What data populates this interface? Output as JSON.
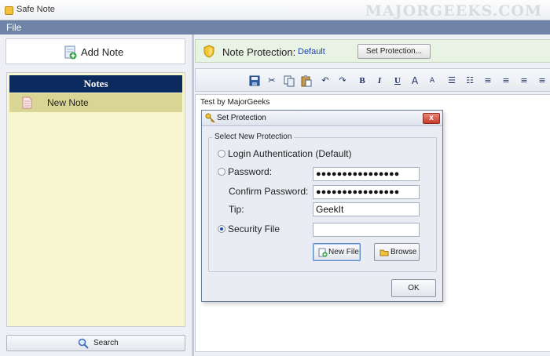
{
  "window": {
    "title": "Safe Note",
    "watermark": "MAJORGEEKS.COM"
  },
  "menu": {
    "file": "File"
  },
  "sidebar": {
    "add_note_label": "Add Note",
    "notes_header": "Notes",
    "notes": [
      {
        "label": "New Note"
      }
    ],
    "search_label": "Search"
  },
  "protection": {
    "label": "Note Protection:",
    "value": "Default",
    "set_button": "Set Protection..."
  },
  "toolbar": {
    "bold": "B",
    "italic": "I",
    "underline": "U",
    "grow_font": "A",
    "shrink_font": "A"
  },
  "editor": {
    "content": "Test by MajorGeeks"
  },
  "dialog": {
    "title": "Set Protection",
    "close": "x",
    "group_label": "Select New Protection",
    "option_login": "Login Authentication (Default)",
    "option_password": "Password:",
    "password_value": "●●●●●●●●●●●●●●●●",
    "confirm_label": "Confirm Password:",
    "confirm_value": "●●●●●●●●●●●●●●●●",
    "tip_label": "Tip:",
    "tip_value": "GeekIt",
    "option_security_file": "Security File",
    "security_file_value": "",
    "new_file_button": "New File",
    "browse_button": "Browse",
    "ok_button": "OK"
  },
  "colors": {
    "menubar": "#6e83a5",
    "notes_header": "#0b2a5e",
    "notes_panel": "#f8f6cf",
    "selected_note": "#d9d595",
    "protection_value": "#1d3fb8"
  }
}
